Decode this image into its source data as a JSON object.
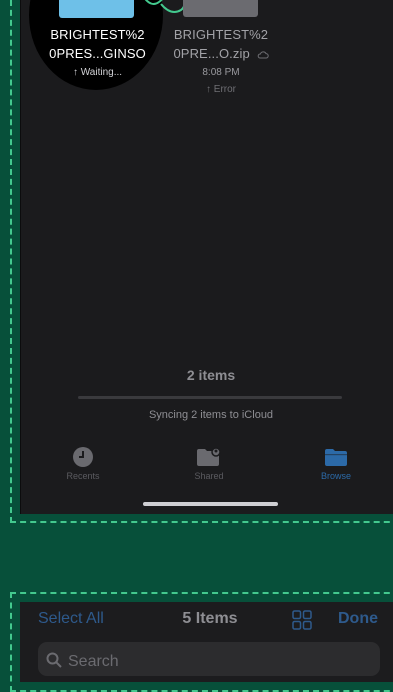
{
  "files": [
    {
      "name_line1": "BRIGHTEST%2",
      "name_line2": "0PRES...GINSO",
      "status": "↑ Waiting..."
    },
    {
      "name_line1": "BRIGHTEST%2",
      "name_line2": "0PRE...O.zip",
      "time": "8:08 PM",
      "status": "↑ Error"
    }
  ],
  "footer": {
    "items_count": "2 items",
    "sync_text": "Syncing 2 items to iCloud",
    "progress": 0
  },
  "tabs": [
    {
      "label": "Recents",
      "icon": "clock-icon"
    },
    {
      "label": "Shared",
      "icon": "shared-folder-icon"
    },
    {
      "label": "Browse",
      "icon": "folder-icon"
    }
  ],
  "toolbar": {
    "select_all": "Select All",
    "title": "5 Items",
    "done": "Done"
  },
  "search": {
    "placeholder": "Search"
  },
  "colors": {
    "accent": "#2e5a8c",
    "background": "#07503a",
    "frame_dash": "#43c98e",
    "thumb_blue": "#6ec0e8"
  }
}
